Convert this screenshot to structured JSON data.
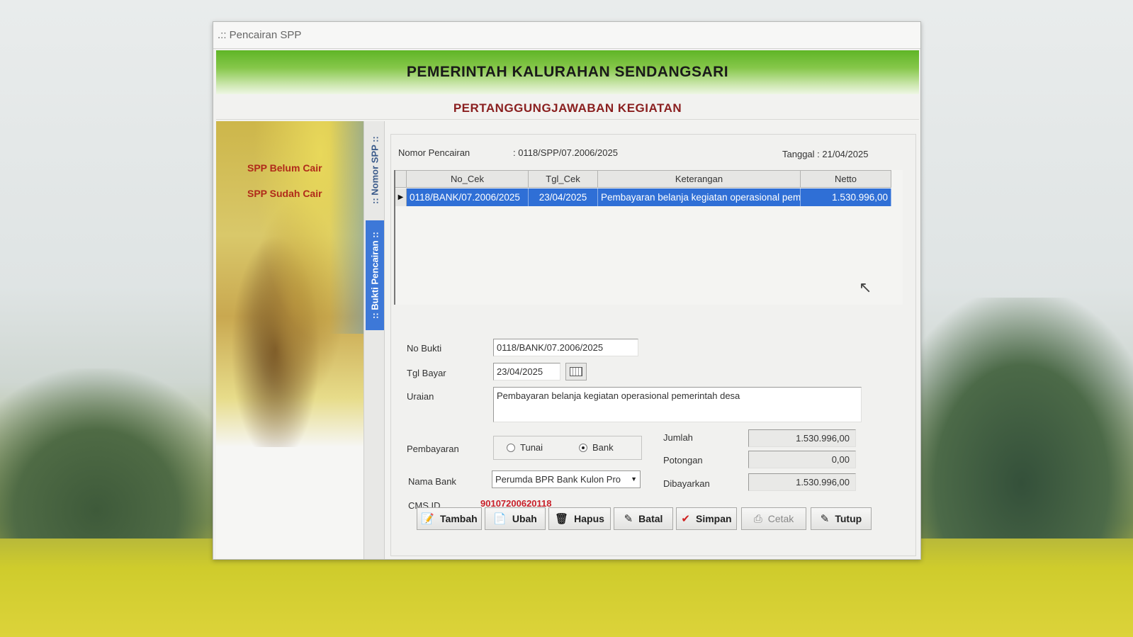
{
  "window": {
    "title": ".:: Pencairan SPP",
    "banner": "PEMERINTAH KALURAHAN SENDANGSARI",
    "subtitle": "PERTANGGUNGJAWABAN KEGIATAN"
  },
  "sidebar": {
    "links": [
      {
        "label": "SPP Belum Cair"
      },
      {
        "label": "SPP Sudah Cair"
      }
    ]
  },
  "tabs": [
    {
      "label": ":: Nomor SPP ::",
      "active": false
    },
    {
      "label": ":: Bukti Pencairan ::",
      "active": true
    }
  ],
  "header": {
    "nomor_label": "Nomor Pencairan",
    "nomor_value": ": 0118/SPP/07.2006/2025",
    "tanggal": "Tanggal : 21/04/2025"
  },
  "grid": {
    "columns": [
      "No_Cek",
      "Tgl_Cek",
      "Keterangan",
      "Netto"
    ],
    "rows": [
      [
        "0118/BANK/07.2006/2025",
        "23/04/2025",
        "Pembayaran belanja kegiatan  operasional pemerintah desa",
        "1.530.996,00"
      ]
    ]
  },
  "form": {
    "no_bukti_label": "No Bukti",
    "no_bukti": "0118/BANK/07.2006/2025",
    "tgl_bayar_label": "Tgl Bayar",
    "tgl_bayar": "23/04/2025",
    "uraian_label": "Uraian",
    "uraian": "Pembayaran belanja kegiatan  operasional pemerintah desa",
    "pembayaran_label": "Pembayaran",
    "pembayaran_options": [
      "Tunai",
      "Bank"
    ],
    "pembayaran_selected": "Bank",
    "nama_bank_label": "Nama Bank",
    "nama_bank": "Perumda BPR Bank Kulon Pro",
    "cms_label": "CMS ID",
    "cms_id": "90107200620118",
    "jumlah_label": "Jumlah",
    "jumlah": "1.530.996,00",
    "potongan_label": "Potongan",
    "potongan": "0,00",
    "dibayarkan_label": "Dibayarkan",
    "dibayarkan": "1.530.996,00"
  },
  "buttons": {
    "tambah": "Tambah",
    "ubah": "Ubah",
    "hapus": "Hapus",
    "batal": "Batal",
    "simpan": "Simpan",
    "cetak": "Cetak",
    "tutup": "Tutup"
  },
  "colors": {
    "selection": "#2f6fd6",
    "banner_green": "#5fb526",
    "link_red": "#b02a1a",
    "cms_red": "#c8202a"
  }
}
